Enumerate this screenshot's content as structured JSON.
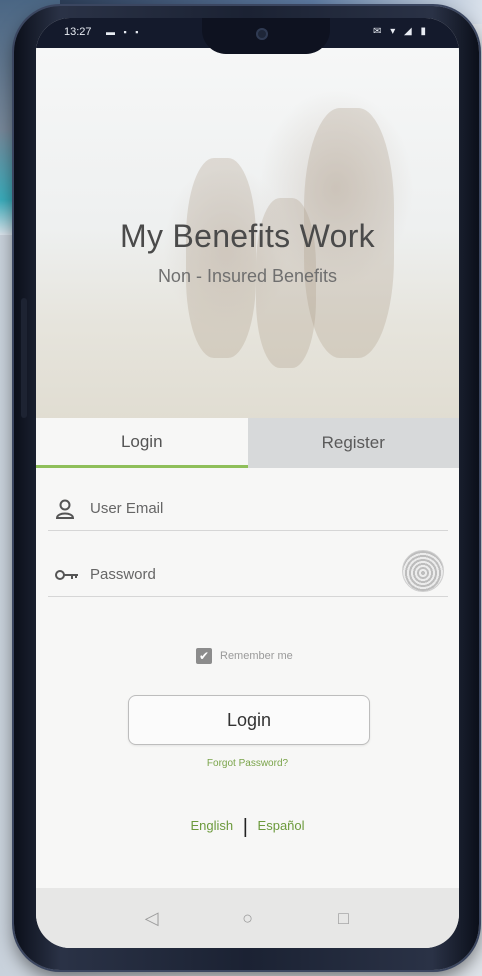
{
  "status_bar": {
    "time": "13:27",
    "left_icons": "▬ ▪ ▪",
    "right_icons": "✉ ▾ ◢ ▮"
  },
  "hero": {
    "title": "My Benefits Work",
    "subtitle": "Non - Insured Benefits"
  },
  "tabs": [
    {
      "label": "Login",
      "active": true
    },
    {
      "label": "Register",
      "active": false
    }
  ],
  "form": {
    "email_placeholder": "User Email",
    "password_placeholder": "Password",
    "remember_label": "Remember me",
    "remember_checked": true,
    "login_button": "Login",
    "forgot_link": "Forgot Password?"
  },
  "languages": {
    "english": "English",
    "separator": "|",
    "spanish": "Español"
  },
  "nav": {
    "back": "◁",
    "home": "○",
    "recents": "□"
  },
  "colors": {
    "accent_green": "#8fbf5a",
    "link_green": "#6c9a3c",
    "tab_inactive": "#d7d9da"
  },
  "icons": {
    "user": "user-icon",
    "key": "key-icon",
    "fingerprint": "fingerprint-icon",
    "checkbox": "checkbox-checked-icon"
  }
}
